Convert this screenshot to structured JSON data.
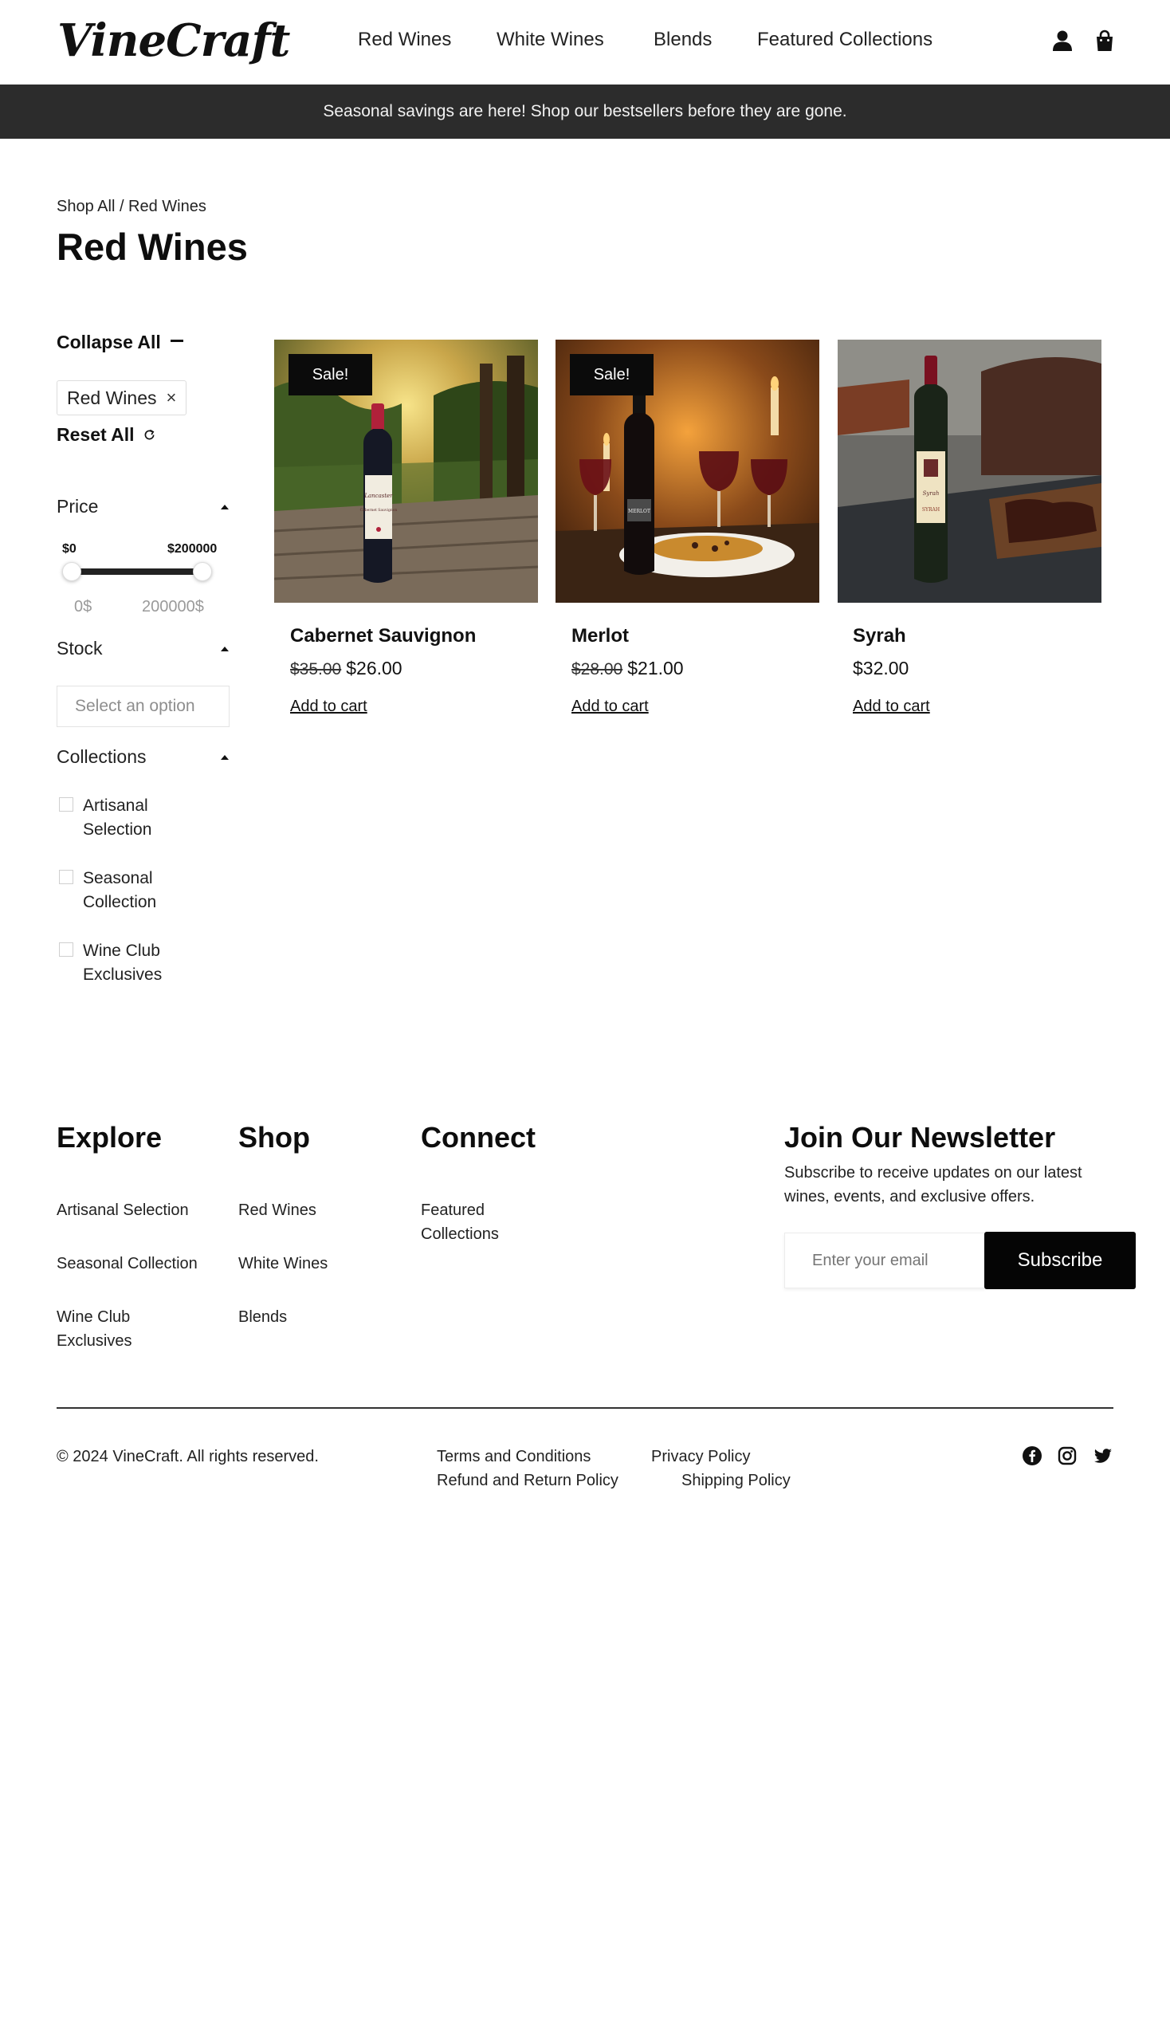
{
  "brand": {
    "logo_text": "VineCraft"
  },
  "nav": {
    "links": [
      "Red Wines",
      "White Wines",
      "Blends",
      "Featured Collections"
    ],
    "icons": [
      "user-icon",
      "shopping-bag-icon"
    ]
  },
  "promo": {
    "text": "Seasonal savings are here! Shop our bestsellers before they are gone."
  },
  "breadcrumb": {
    "text": "Shop All / Red Wines"
  },
  "page": {
    "title": "Red Wines"
  },
  "filters": {
    "collapse_label": "Collapse All",
    "active_chip": "Red Wines",
    "chip_close": "×",
    "reset_label": "Reset All",
    "price": {
      "label": "Price",
      "min_label": "$0",
      "max_label": "$200000",
      "min_value": "0$",
      "max_value": "200000$",
      "selected_min_fraction": 0.0,
      "selected_max_fraction": 1.0
    },
    "stock": {
      "label": "Stock",
      "placeholder": "Select an option"
    },
    "collections": {
      "label": "Collections",
      "options": [
        "Artisanal Selection",
        "Seasonal Collection",
        "Wine Club Exclusives"
      ]
    }
  },
  "products": [
    {
      "name": "Cabernet Sauvignon",
      "badge": "Sale!",
      "old_price": "$35.00",
      "price": "$26.00",
      "cta": "Add to cart"
    },
    {
      "name": "Merlot",
      "badge": "Sale!",
      "old_price": "$28.00",
      "price": "$21.00",
      "cta": "Add to cart"
    },
    {
      "name": "Syrah",
      "badge": "",
      "old_price": "",
      "price": "$32.00",
      "cta": "Add to cart"
    }
  ],
  "product_image_text": {
    "bottle_1": "Cabernet Sauvignon",
    "bottle_2": "MERLOT",
    "bottle_3": "Syrah"
  },
  "footer": {
    "explore": {
      "heading": "Explore",
      "links": [
        "Artisanal Selection",
        "Seasonal Collection",
        "Wine Club Exclusives"
      ]
    },
    "shop": {
      "heading": "Shop",
      "links": [
        "Red Wines",
        "White Wines",
        "Blends"
      ]
    },
    "connect": {
      "heading": "Connect",
      "links": [
        "Featured Collections"
      ]
    },
    "newsletter": {
      "heading": "Join Our Newsletter",
      "description": "Subscribe to receive updates on our latest wines, events, and exclusive offers.",
      "placeholder": "Enter your email",
      "button": "Subscribe"
    },
    "copyright": "© 2024 VineCraft. All rights reserved.",
    "legal_links": [
      "Terms and Conditions",
      "Privacy Policy",
      "Refund and Return Policy",
      "Shipping Policy"
    ],
    "social_icons": [
      "facebook-icon",
      "instagram-icon",
      "twitter-icon"
    ]
  }
}
